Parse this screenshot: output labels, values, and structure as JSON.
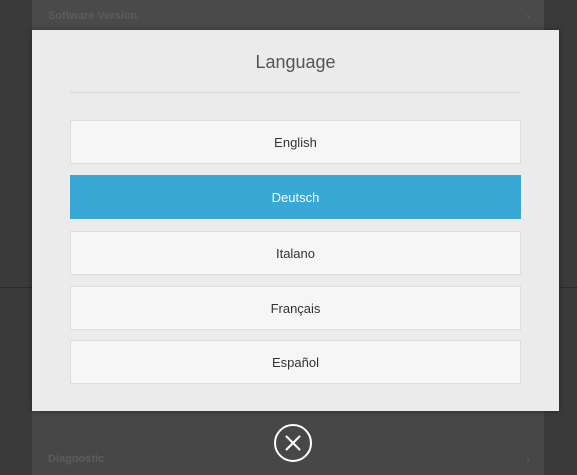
{
  "background": {
    "top_row_label": "Software Version",
    "bottom_row_label": "Diagnostic"
  },
  "dialog": {
    "title": "Language",
    "options": [
      {
        "label": "English",
        "selected": false
      },
      {
        "label": "Deutsch",
        "selected": true
      },
      {
        "label": "Italano",
        "selected": false
      },
      {
        "label": "Français",
        "selected": false
      },
      {
        "label": "Español",
        "selected": false
      }
    ],
    "close_icon": "close-circle-icon"
  },
  "colors": {
    "selected": "#39a8d5",
    "dialog_bg": "#ebebeb",
    "option_bg": "#f6f6f6"
  }
}
